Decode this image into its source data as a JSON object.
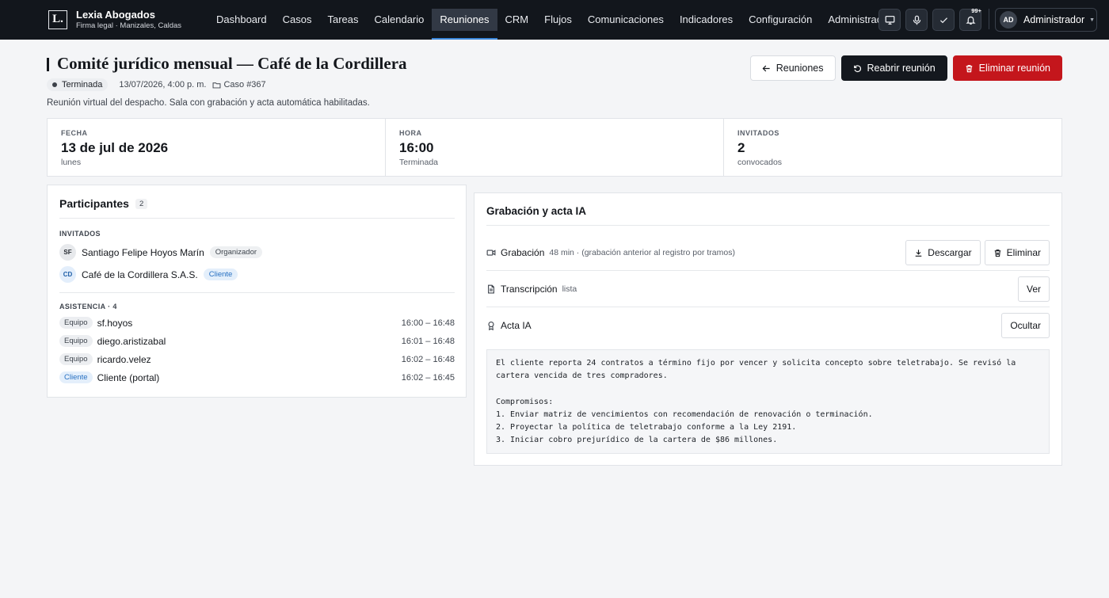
{
  "brand": {
    "logo_letter": "L.",
    "name": "Lexia Abogados",
    "subtitle": "Firma legal · Manizales, Caldas"
  },
  "nav": {
    "items": [
      {
        "label": "Dashboard"
      },
      {
        "label": "Casos"
      },
      {
        "label": "Tareas"
      },
      {
        "label": "Calendario"
      },
      {
        "label": "Reuniones",
        "active": true
      },
      {
        "label": "CRM"
      },
      {
        "label": "Flujos"
      },
      {
        "label": "Comunicaciones"
      },
      {
        "label": "Indicadores"
      },
      {
        "label": "Configuración"
      },
      {
        "label": "Administración"
      }
    ]
  },
  "toolbar": {
    "icons": [
      "monitor-icon",
      "microphone-icon",
      "check-icon",
      "bell-icon"
    ],
    "notifications_badge": "99+"
  },
  "user": {
    "initials": "AD",
    "name": "Administrador"
  },
  "meeting": {
    "title": "Comité jurídico mensual — Café de la Cordillera",
    "status": "Terminada",
    "datetime": "13/07/2026, 4:00 p. m.",
    "case": "Caso #367",
    "description": "Reunión virtual del despacho. Sala con grabación y acta automática habilitadas."
  },
  "actions": {
    "back_label": "Reuniones",
    "reopen_label": "Reabrir reunión",
    "delete_label": "Eliminar reunión",
    "danger_color": "#c4161c"
  },
  "stats": [
    {
      "label": "FECHA",
      "value": "13 de jul de 2026",
      "sub": "lunes"
    },
    {
      "label": "HORA",
      "value": "16:00",
      "sub": "Terminada"
    },
    {
      "label": "INVITADOS",
      "value": "2",
      "sub": "convocados"
    }
  ],
  "participants": {
    "title": "Participantes",
    "count": "2",
    "invited_label": "INVITADOS",
    "invited": [
      {
        "initials": "SF",
        "name": "Santiago Felipe Hoyos Marín",
        "role": "Organizador"
      },
      {
        "initials": "CD",
        "name": "Café de la Cordillera S.A.S.",
        "role": "Cliente"
      }
    ],
    "attendance_label": "ASISTENCIA · 4",
    "attendance": [
      {
        "type": "Equipo",
        "name": "sf.hoyos",
        "time": "16:00 – 16:48"
      },
      {
        "type": "Equipo",
        "name": "diego.aristizabal",
        "time": "16:01 – 16:48"
      },
      {
        "type": "Equipo",
        "name": "ricardo.velez",
        "time": "16:02 – 16:48"
      },
      {
        "type": "Cliente",
        "name": "Cliente (portal)",
        "time": "16:02 – 16:45"
      }
    ]
  },
  "recording": {
    "title": "Grabación y acta IA",
    "recording_label": "Grabación",
    "recording_note": "48 min · (grabación anterior al registro por tramos)",
    "download_label": "Descargar",
    "delete_label": "Eliminar",
    "transcript_label": "Transcripción",
    "transcript_status": "lista",
    "view_label": "Ver",
    "minutes_label": "Acta IA",
    "hide_label": "Ocultar",
    "minutes_text": "El cliente reporta 24 contratos a término fijo por vencer y solicita concepto sobre teletrabajo. Se revisó la cartera vencida de tres compradores.\n\nCompromisos:\n1. Enviar matriz de vencimientos con recomendación de renovación o terminación.\n2. Proyectar la política de teletrabajo conforme a la Ley 2191.\n3. Iniciar cobro prejurídico de la cartera de $86 millones."
  }
}
